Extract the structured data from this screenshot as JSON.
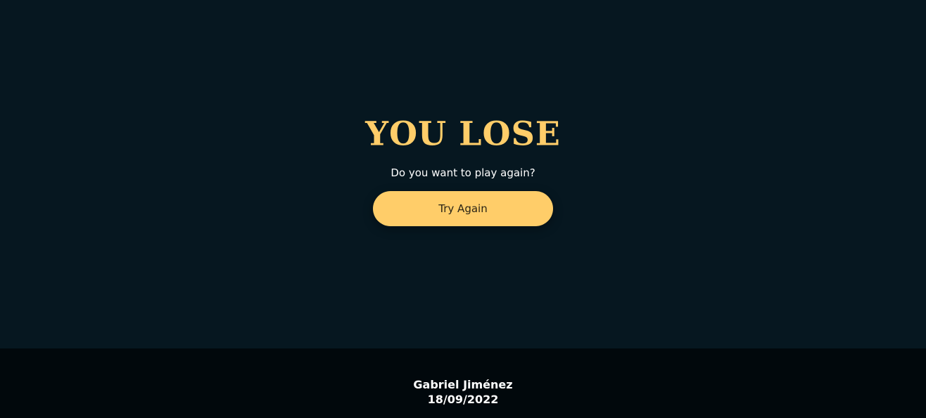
{
  "game_over": {
    "title": "YOU LOSE",
    "prompt": "Do you want to play again?",
    "try_again_label": "Try Again"
  },
  "footer": {
    "author": "Gabriel Jiménez",
    "date": "18/09/2022"
  },
  "colors": {
    "background": "#061720",
    "footer_background": "#01080c",
    "accent": "#ffcd69",
    "text": "#ffffff"
  }
}
